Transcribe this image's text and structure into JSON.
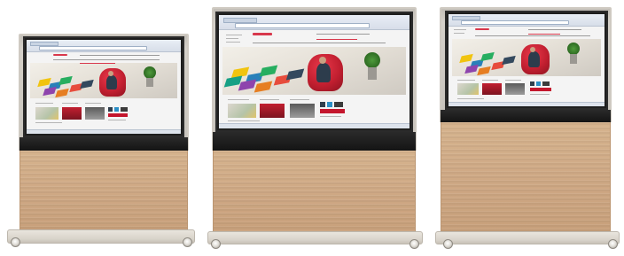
{
  "scene": {
    "description_visible_text": "",
    "stand_count": 3,
    "colors": {
      "background": "#ffffff",
      "frame": "#cfcac2",
      "monitor_bezel": "#1e1e1e",
      "wood_panel": "#cfa985",
      "base": "#e0dcd4",
      "brand_accent": "#d8384c",
      "chair_red": "#c21f30"
    }
  }
}
